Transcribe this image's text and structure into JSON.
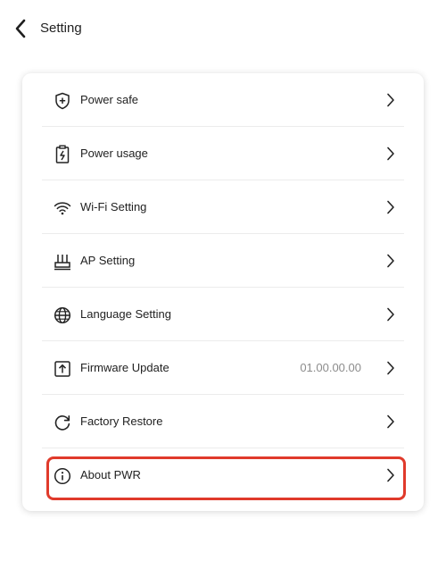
{
  "header": {
    "title": "Setting"
  },
  "menu": {
    "items": [
      {
        "icon": "shield-plus-icon",
        "label": "Power safe"
      },
      {
        "icon": "battery-clipboard-icon",
        "label": "Power usage"
      },
      {
        "icon": "wifi-icon",
        "label": "Wi-Fi Setting"
      },
      {
        "icon": "router-icon",
        "label": "AP Setting"
      },
      {
        "icon": "globe-icon",
        "label": "Language Setting"
      },
      {
        "icon": "upload-icon",
        "label": "Firmware Update",
        "value": "01.00.00.00"
      },
      {
        "icon": "refresh-icon",
        "label": "Factory Restore"
      },
      {
        "icon": "info-icon",
        "label": "About PWR"
      }
    ]
  },
  "colors": {
    "highlight": "#e03a2b",
    "divider": "#ececec",
    "value_text": "#8c8c8c"
  }
}
